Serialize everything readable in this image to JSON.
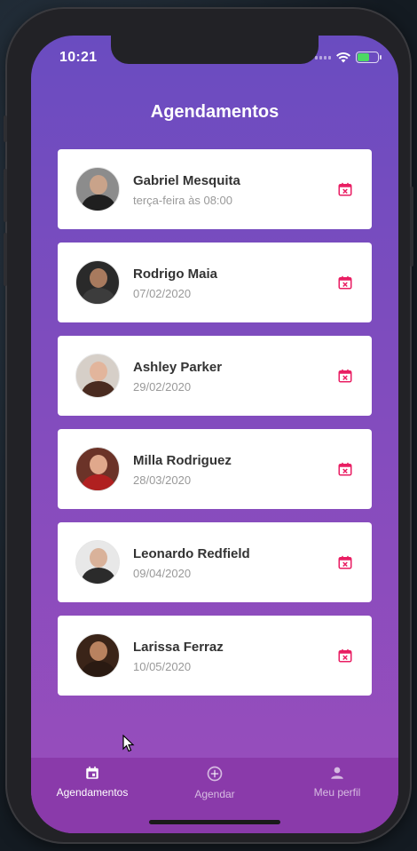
{
  "status_bar": {
    "time": "10:21"
  },
  "page": {
    "title": "Agendamentos"
  },
  "appointments": [
    {
      "name": "Gabriel Mesquita",
      "date": "terça-feira às 08:00",
      "avatar_skin": "#c9a38a",
      "avatar_shirt": "#1f1f1f",
      "avatar_bg": "#8c8c8c"
    },
    {
      "name": "Rodrigo Maia",
      "date": "07/02/2020",
      "avatar_skin": "#a87a5e",
      "avatar_shirt": "#3c3c3c",
      "avatar_bg": "#2a2a2a"
    },
    {
      "name": "Ashley Parker",
      "date": "29/02/2020",
      "avatar_skin": "#e2b59c",
      "avatar_shirt": "#4a2b20",
      "avatar_bg": "#d6cfc8"
    },
    {
      "name": "Milla Rodriguez",
      "date": "28/03/2020",
      "avatar_skin": "#e0a88c",
      "avatar_shirt": "#b02020",
      "avatar_bg": "#6b3328"
    },
    {
      "name": "Leonardo Redfield",
      "date": "09/04/2020",
      "avatar_skin": "#d9b29a",
      "avatar_shirt": "#2b2b2b",
      "avatar_bg": "#e8e8e8"
    },
    {
      "name": "Larissa Ferraz",
      "date": "10/05/2020",
      "avatar_skin": "#b9825f",
      "avatar_shirt": "#2a1a12",
      "avatar_bg": "#3a2418"
    }
  ],
  "tabs": [
    {
      "label": "Agendamentos",
      "icon": "calendar-icon",
      "active": true
    },
    {
      "label": "Agendar",
      "icon": "add-circle-icon",
      "active": false
    },
    {
      "label": "Meu perfil",
      "icon": "person-icon",
      "active": false
    }
  ],
  "colors": {
    "accent": "#e91e63",
    "gradient_top": "#6a4cc0",
    "gradient_bottom": "#9a4dbc",
    "tab_bar": "#8a3aaa"
  }
}
